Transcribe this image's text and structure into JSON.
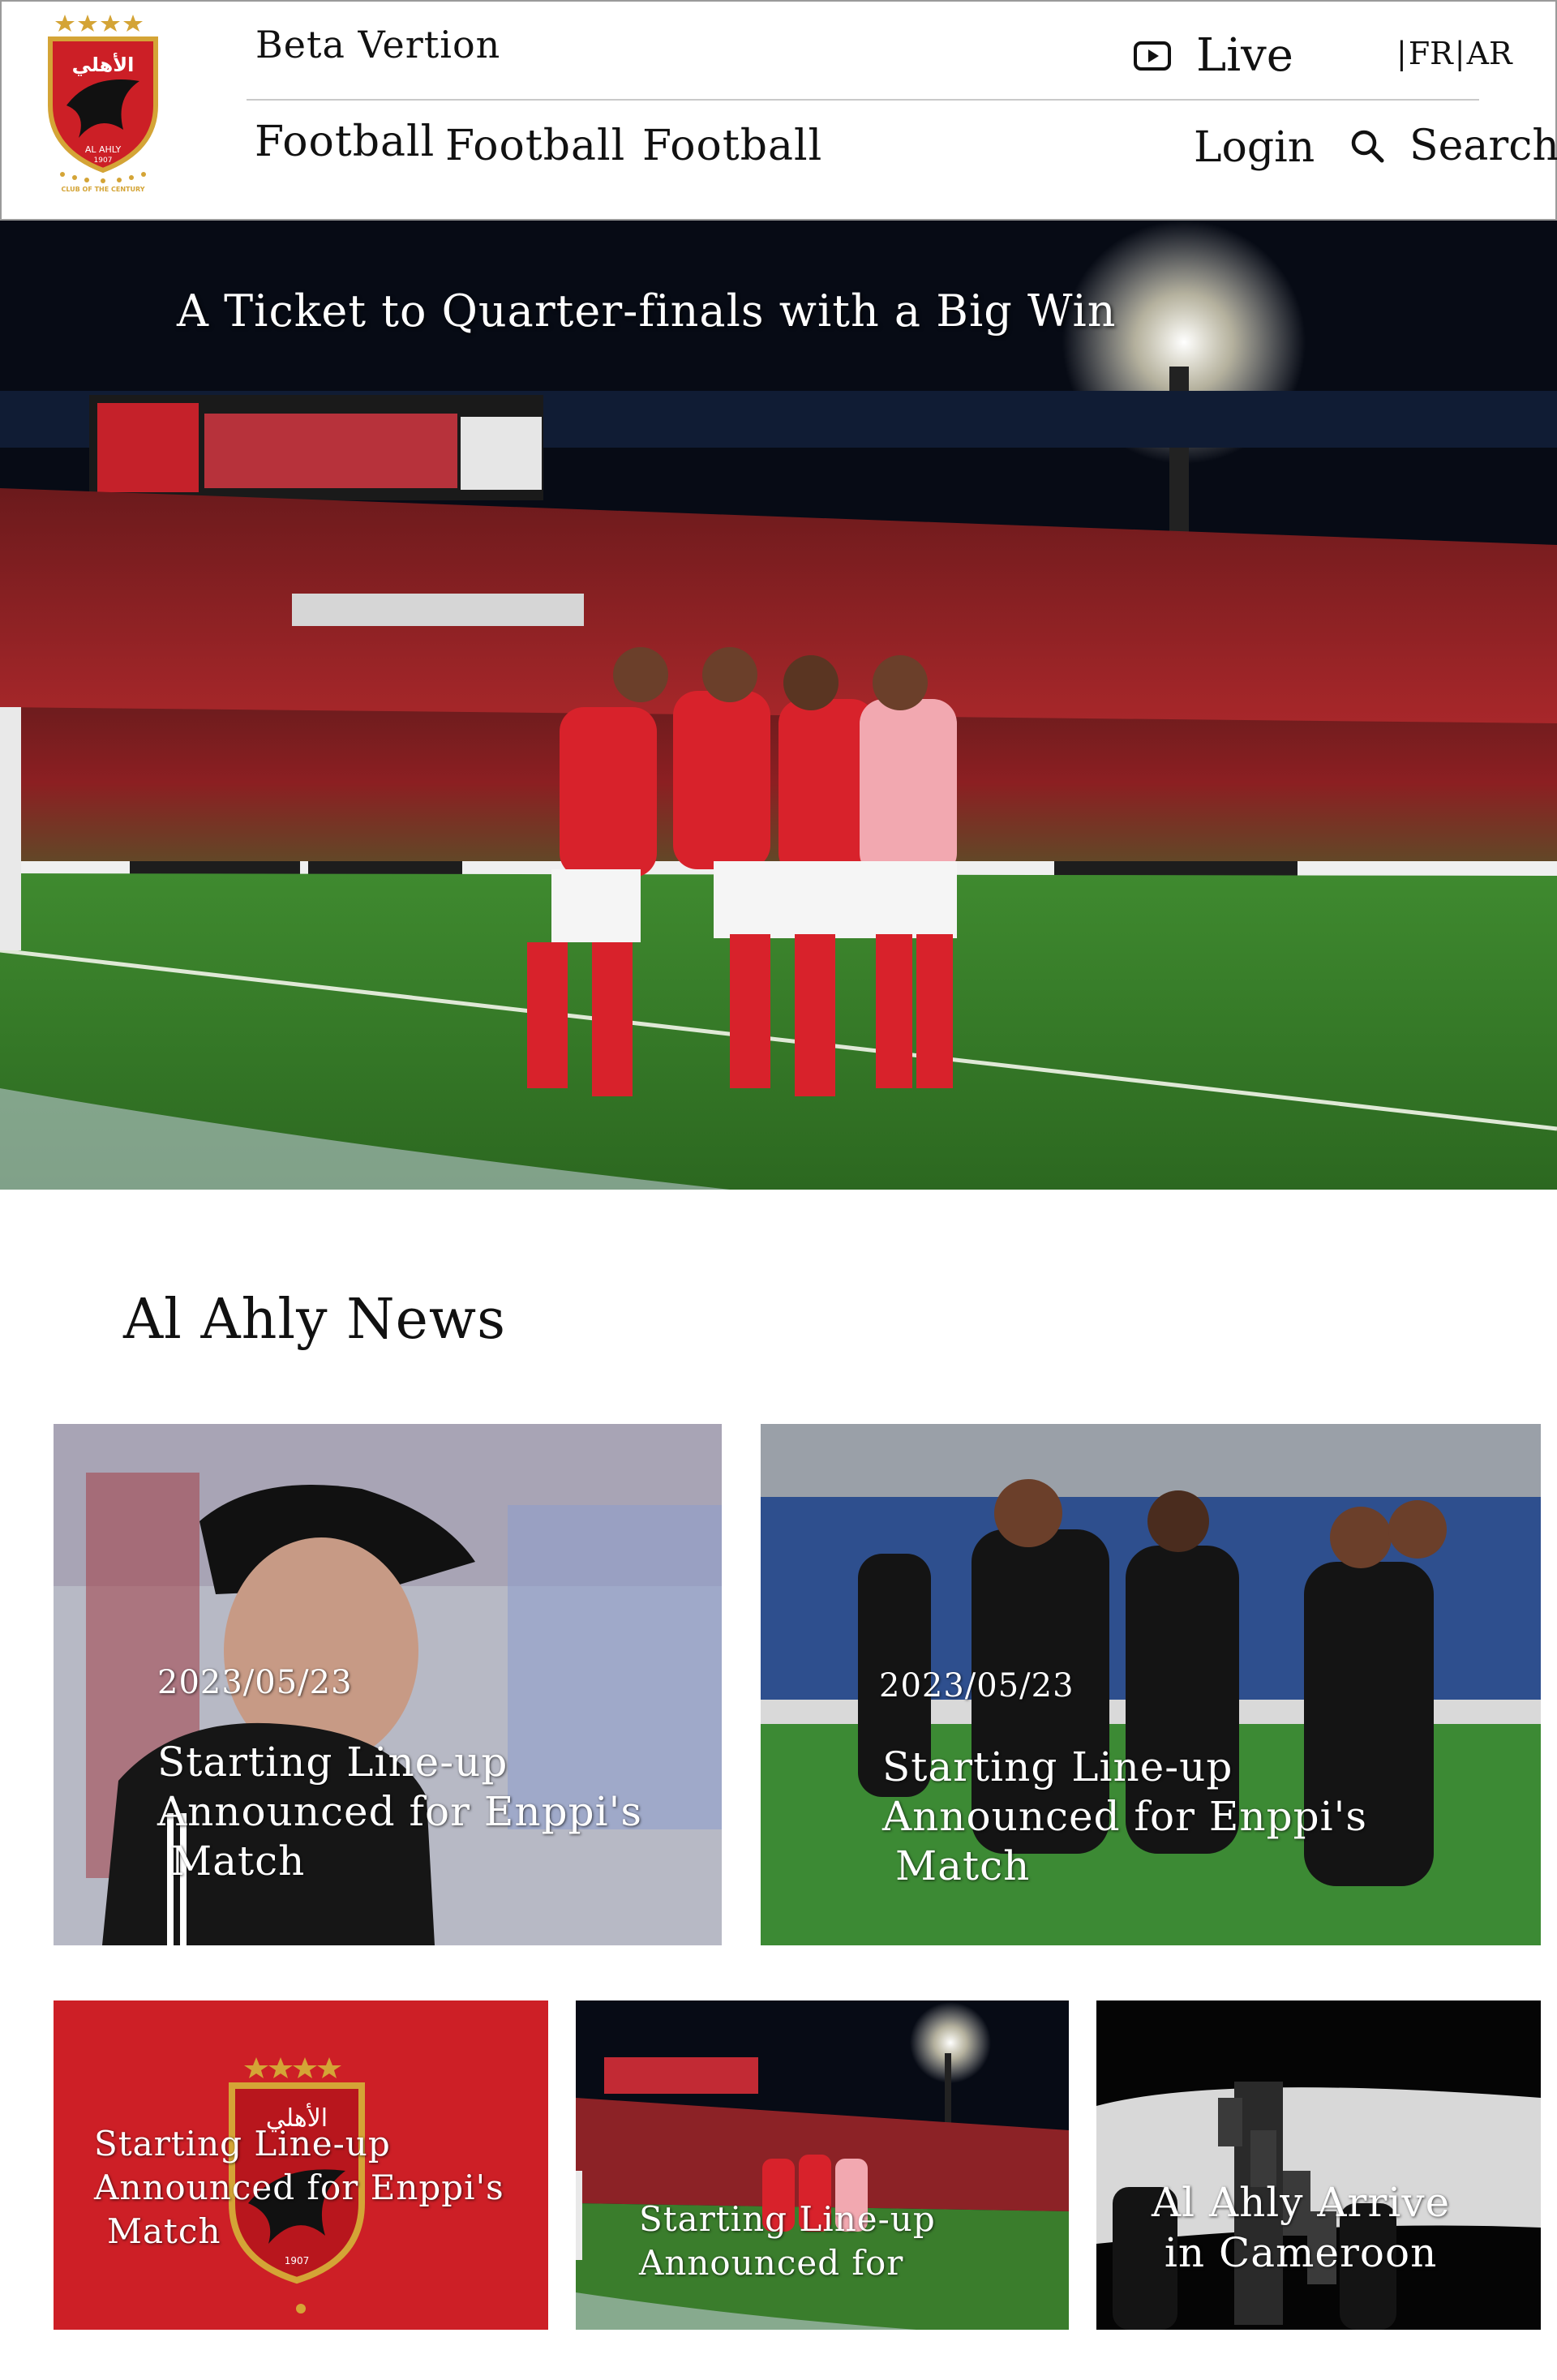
{
  "header": {
    "logo": {
      "name": "al-ahly-logo",
      "text_lines": [
        "الأهلي",
        "AL AHLY",
        "1907",
        "CLUB OF THE CENTURY"
      ]
    },
    "beta_label": "Beta Vertion",
    "live_label": "Live",
    "lang": {
      "fr": "FR",
      "ar": "AR",
      "sep": "|"
    },
    "nav": [
      "Football",
      "Football",
      "Football"
    ],
    "login_label": "Login",
    "search_label": "Search",
    "icons": {
      "live": "play-icon",
      "search": "search-icon"
    }
  },
  "hero": {
    "title": "A Ticket to Quarter-finals with a Big Win"
  },
  "news": {
    "section_title": "Al Ahly News",
    "cards": [
      {
        "date": "2023/05/23",
        "title_lines": [
          "Starting Line-up",
          "Announced for Enppi's",
          "Match"
        ]
      },
      {
        "date": "2023/05/23",
        "title_lines": [
          "Starting Line-up",
          "Announced for Enppi's",
          "Match"
        ]
      },
      {
        "title_lines": [
          "Starting Line-up",
          "Announced for Enppi's",
          "Match"
        ]
      },
      {
        "title_lines": [
          "Starting Line-up",
          "Announced for"
        ]
      },
      {
        "title_lines": [
          "Al Ahly Arrive",
          "in Cameroon"
        ]
      }
    ]
  },
  "colors": {
    "brand_red": "#cc1f26",
    "gold": "#d4a436",
    "text": "#111111",
    "white": "#ffffff"
  }
}
